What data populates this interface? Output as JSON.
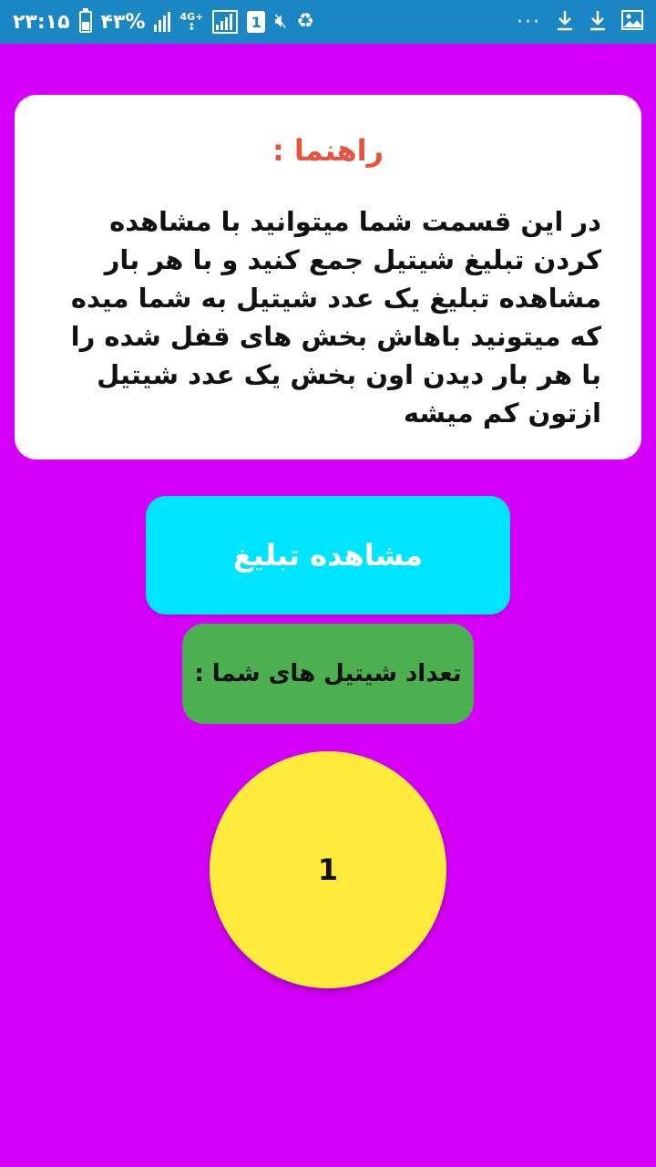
{
  "status_bar": {
    "time": "۲۳:۱۵",
    "battery_percent": "۴۳%",
    "network_type": "4G+",
    "sim_slot": "1",
    "more_dots": "···",
    "icons": [
      "battery-icon",
      "signal-icon",
      "signal-box-icon",
      "sim-icon",
      "mute-icon",
      "recycle-icon",
      "download-icon",
      "download-icon",
      "image-icon"
    ],
    "background_color": "#1b86c4"
  },
  "guide": {
    "title": "راهنما :",
    "body": "در این قسمت شما میتوانید با مشاهده کردن تبلیغ شیتیل جمع کنید و با هر بار مشاهده تبلیغ یک عدد شیتیل به شما میده که میتونید باهاش بخش های قفل شده را با هر بار دیدن اون بخش یک عدد شیتیل ازتون کم میشه",
    "title_color": "#e8533e"
  },
  "watch_ad_button": {
    "label": "مشاهده تبلیغ",
    "color": "#00e5ff"
  },
  "shitil_count": {
    "label": "تعداد شیتیل های شما :",
    "value": "1",
    "label_bg_color": "#4caf50",
    "circle_color": "#ffeb3b"
  },
  "theme": {
    "background_color": "#d500f9"
  }
}
